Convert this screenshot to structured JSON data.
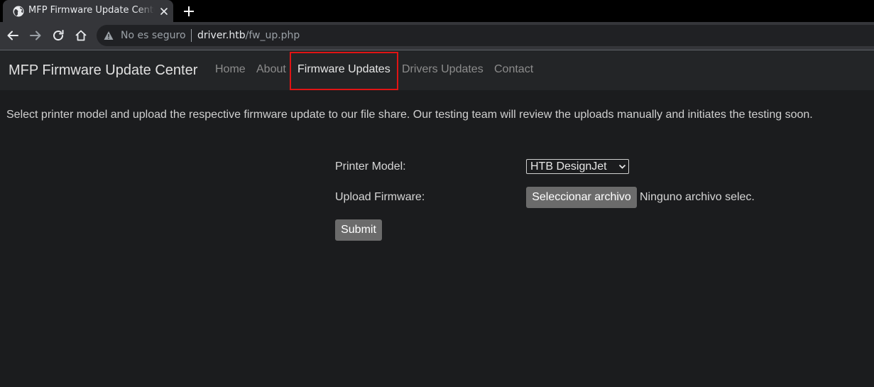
{
  "browser": {
    "tab_title": "MFP Firmware Update Center",
    "security_label": "No es seguro",
    "url_host": "driver.htb",
    "url_path": "/fw_up.php"
  },
  "site": {
    "brand": "MFP Firmware Update Center",
    "nav": {
      "home": "Home",
      "about": "About",
      "firmware_updates": "Firmware Updates",
      "drivers_updates": "Drivers Updates",
      "contact": "Contact"
    },
    "active_nav": "Firmware Updates",
    "highlight_color": "#e01414"
  },
  "main": {
    "intro": "Select printer model and upload the respective firmware update to our file share. Our testing team will review the uploads manually and initiates the testing soon.",
    "form": {
      "printer_model_label": "Printer Model:",
      "printer_model_value": "HTB DesignJet",
      "upload_label": "Upload Firmware:",
      "file_button_label": "Seleccionar archivo",
      "file_status": "Ninguno archivo selec.",
      "submit_label": "Submit"
    }
  }
}
